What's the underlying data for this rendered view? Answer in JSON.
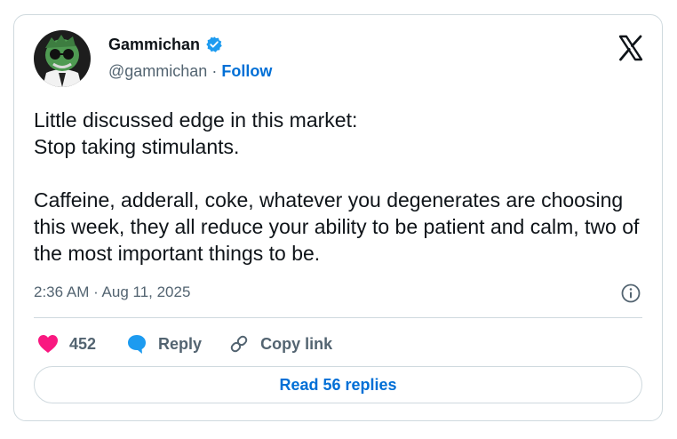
{
  "author": {
    "display_name": "Gammichan",
    "handle": "@gammichan",
    "separator": "·",
    "follow_label": "Follow"
  },
  "tweet": {
    "text": "Little discussed edge in this market:\nStop taking stimulants.\n\nCaffeine, adderall, coke, whatever you degenerates are choosing this week, they all reduce your ability to be patient and calm, two of the most important things to be.",
    "timestamp": "2:36 AM · Aug 11, 2025"
  },
  "actions": {
    "like_count": "452",
    "reply_label": "Reply",
    "copy_link_label": "Copy link"
  },
  "read_replies_label": "Read 56 replies",
  "colors": {
    "accent": "#006fd6",
    "like": "#f91880",
    "reply_icon": "#1d9bf0",
    "verified": "#1d9bf0",
    "muted": "#536471",
    "border": "#cfd9de"
  },
  "icons": {
    "verified": "verified-badge-icon",
    "brand": "x-logo-icon",
    "info": "info-icon",
    "like": "heart-icon",
    "reply": "speech-bubble-icon",
    "copy_link": "link-icon"
  }
}
